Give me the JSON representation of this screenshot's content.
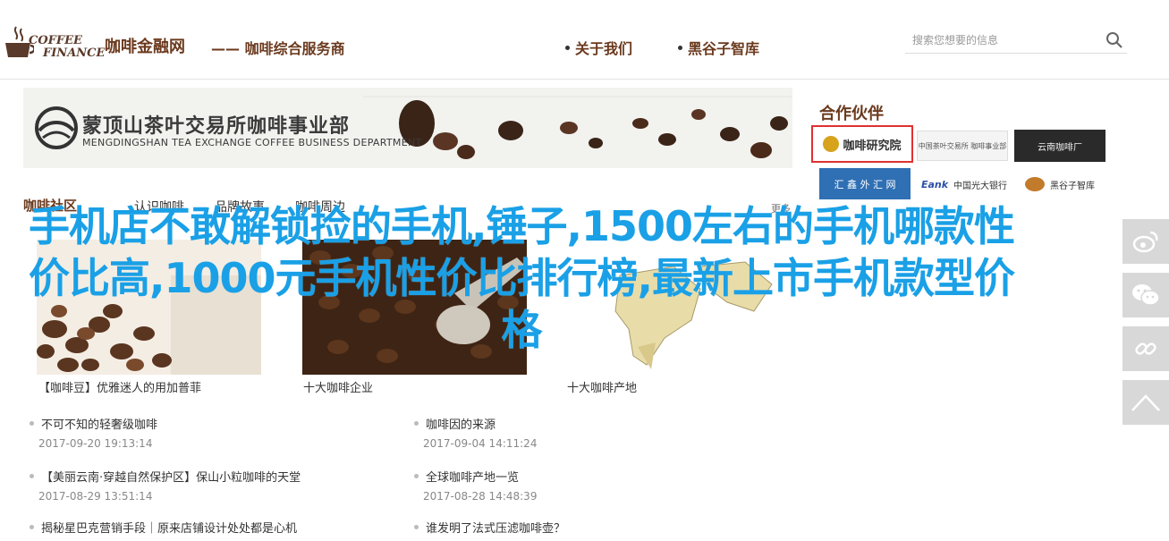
{
  "header": {
    "logo": {
      "line1": "COFFEE",
      "line2": "FINANCE",
      "icon": "coffee-cup-logo"
    },
    "site_title": "咖啡金融网",
    "tagline": "—— 咖啡综合服务商",
    "nav": [
      {
        "label": "关于我们"
      },
      {
        "label": "黑谷子智库"
      }
    ],
    "search": {
      "placeholder": "搜索您想要的信息",
      "icon": "search-icon"
    }
  },
  "banner": {
    "title": "蒙顶山茶叶交易所咖啡事业部",
    "subtitle": "MENGDINGSHAN TEA EXCHANGE COFFEE BUSINESS DEPARTMENT"
  },
  "partners": {
    "title": "合作伙伴",
    "items": [
      {
        "label": "咖啡研究院"
      },
      {
        "label": "中国茶叶交易所 咖啡事业部"
      },
      {
        "label": "云南咖啡厂"
      },
      {
        "label": "汇 鑫 外 汇 网"
      },
      {
        "brand": "Eank",
        "label": "中国光大银行"
      },
      {
        "label": "黑谷子智库"
      }
    ]
  },
  "section": {
    "tabs": [
      "咖啡社区",
      "认识咖啡",
      "品牌故事",
      "咖啡周边"
    ],
    "more": "更多"
  },
  "cards": [
    {
      "caption": "【咖啡豆】优雅迷人的用加普菲"
    },
    {
      "caption": "十大咖啡企业"
    },
    {
      "caption": "十大咖啡产地"
    }
  ],
  "news_left": [
    {
      "title": "不可不知的轻奢级咖啡",
      "date": "2017-09-20 19:13:14"
    },
    {
      "title": "【美丽云南·穿越自然保护区】保山小粒咖啡的天堂",
      "date": "2017-08-29 13:51:14"
    },
    {
      "title": "揭秘星巴克营销手段｜原来店铺设计处处都是心机",
      "date": ""
    }
  ],
  "news_right": [
    {
      "title": "咖啡因的来源",
      "date": "2017-09-04 14:11:24"
    },
    {
      "title": "全球咖啡产地一览",
      "date": "2017-08-28 14:48:39"
    },
    {
      "title": "谁发明了法式压滤咖啡壶？",
      "date": ""
    }
  ],
  "headline": "手机店不敢解锁捡的手机,锤子,1500左右的手机哪款性价比高,1000元手机性价比排行榜,最新上市手机款型价格",
  "share": [
    "weibo-icon",
    "wechat-icon",
    "link-icon",
    "back-to-top-icon"
  ],
  "colors": {
    "brand": "#6b3a1e",
    "headline": "#1aa0e6",
    "share_bg": "#d8d8d8",
    "partner_highlight": "#e03030"
  }
}
